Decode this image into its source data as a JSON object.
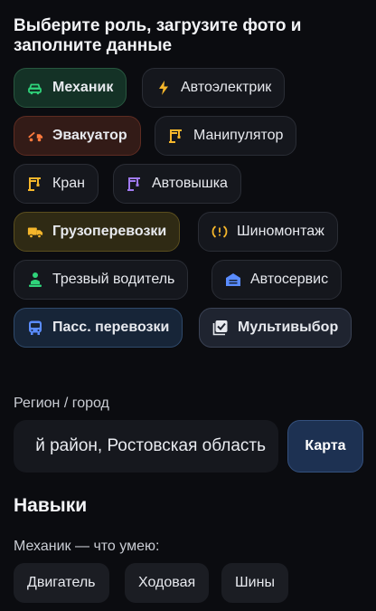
{
  "header": {
    "title": "Выберите роль, загрузите фото и заполните данные"
  },
  "roles": [
    {
      "label": "Механик",
      "icon": "car-wrench-icon"
    },
    {
      "label": "Автоэлектрик",
      "icon": "lightning-icon"
    },
    {
      "label": "Эвакуатор",
      "icon": "tow-truck-icon"
    },
    {
      "label": "Манипулятор",
      "icon": "crane-icon"
    },
    {
      "label": "Кран",
      "icon": "crane-icon"
    },
    {
      "label": "Автовышка",
      "icon": "crane-icon"
    },
    {
      "label": "Грузоперевозки",
      "icon": "truck-icon"
    },
    {
      "label": "Шиномонтаж",
      "icon": "tire-warning-icon"
    },
    {
      "label": "Трезвый водитель",
      "icon": "driver-icon"
    },
    {
      "label": "Автосервис",
      "icon": "garage-icon"
    },
    {
      "label": "Пасс. перевозки",
      "icon": "bus-icon"
    },
    {
      "label": "Мультивыбор",
      "icon": "checkbox-icon"
    }
  ],
  "colors": {
    "green": "#2fd37a",
    "orange": "#ff7a3d",
    "yellow": "#f5b62b",
    "purple": "#a07af0",
    "blue": "#5a8cff"
  },
  "region": {
    "label": "Регион / город",
    "value": "й район, Ростовская область",
    "map_button": "Карта"
  },
  "skills": {
    "title": "Навыки",
    "subtitle": "Механик — что умею:",
    "items": [
      "Двигатель",
      "Ходовая",
      "Шины"
    ]
  }
}
